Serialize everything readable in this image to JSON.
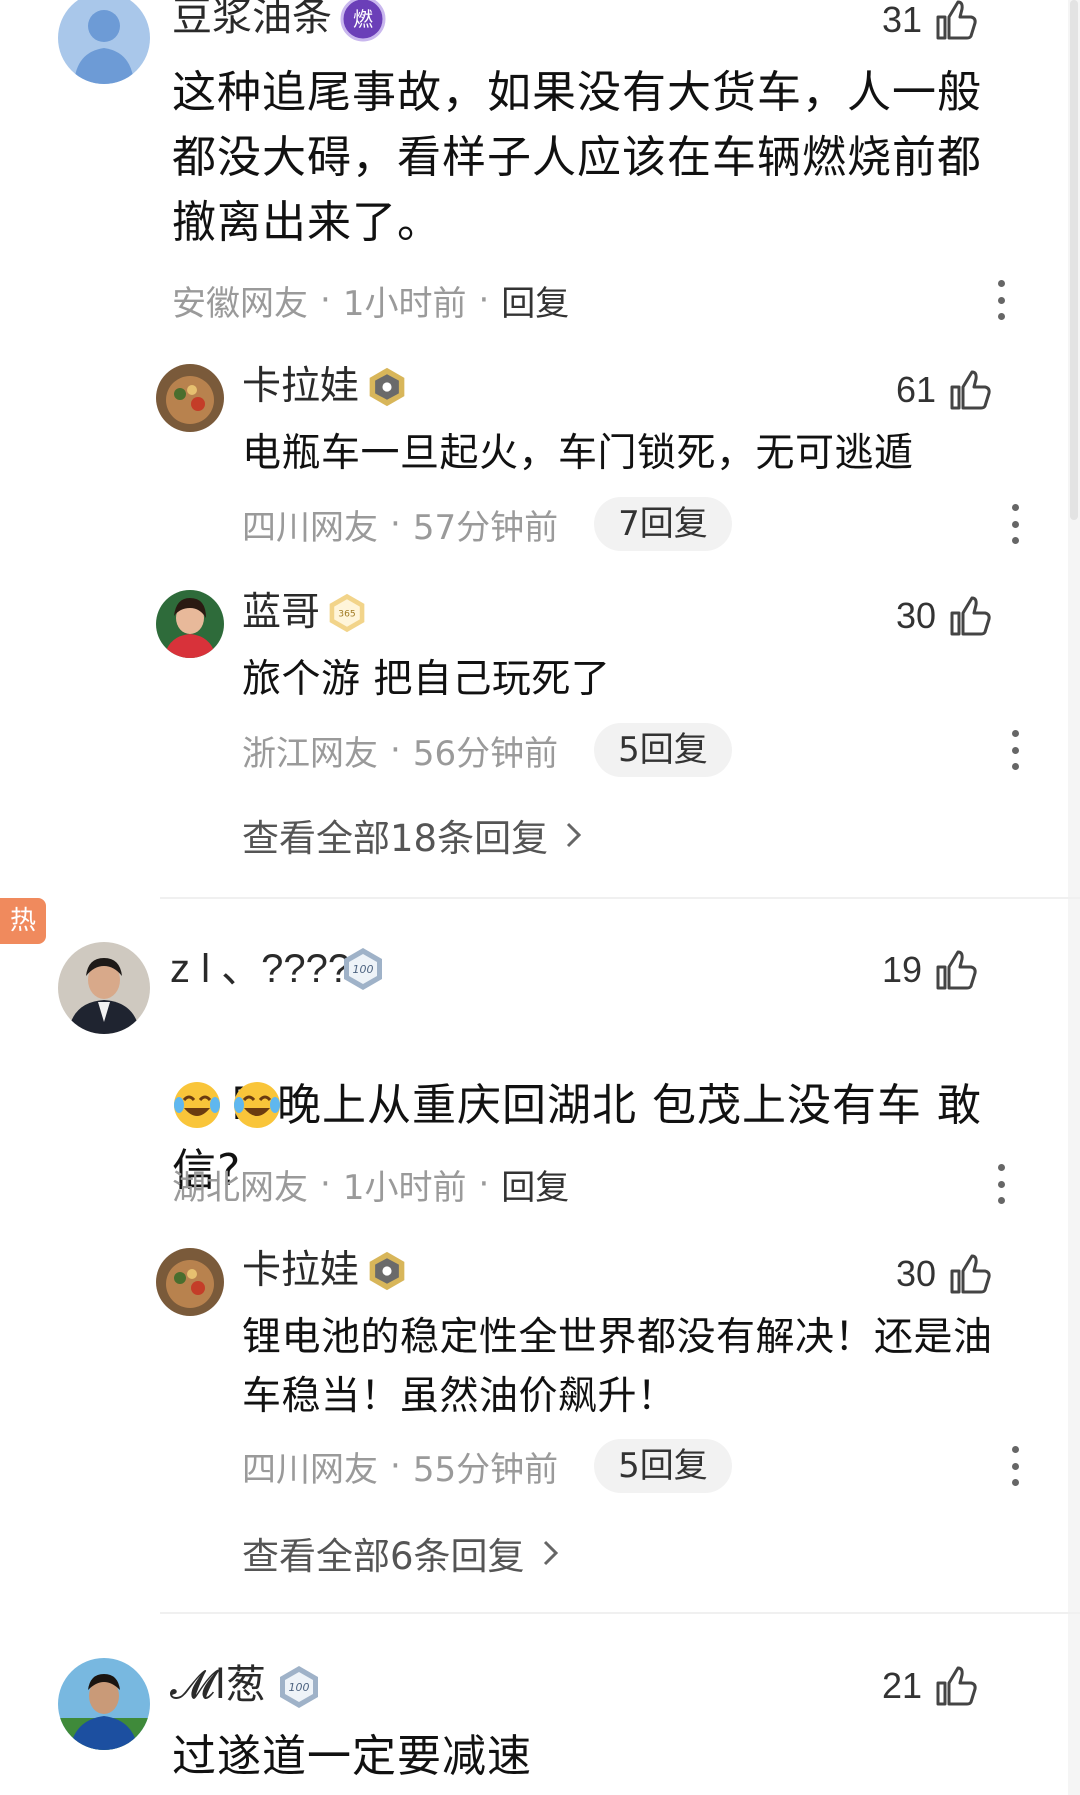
{
  "comments": [
    {
      "username": "豆浆油条",
      "badge_text": "燃",
      "likes": "31",
      "content": "这种追尾事故，如果没有大货车，人一般\n都没大碍，看样子人应该在车辆燃烧前都\n撤离出来了。",
      "location": "安徽网友",
      "time": "1小时前",
      "reply_label": "回复",
      "replies": [
        {
          "username": "卡拉娃",
          "likes": "61",
          "content": "电瓶车一旦起火，车门锁死，无可逃遁",
          "location": "四川网友",
          "time": "57分钟前",
          "reply_count": "7回复"
        },
        {
          "username": "蓝哥",
          "badge_text": "365",
          "likes": "30",
          "content": "旅个游 把自己玩死了",
          "location": "浙江网友",
          "time": "56分钟前",
          "reply_count": "5回复"
        }
      ],
      "view_all": "查看全部18条回复"
    },
    {
      "username": "z l 、????",
      "badge_text": "100",
      "likes": "19",
      "content": "昨晚上从重庆回湖北 包茂上没有车 敢信?",
      "location": "湖北网友",
      "time": "1小时前",
      "reply_label": "回复",
      "replies": [
        {
          "username": "卡拉娃",
          "likes": "30",
          "content": "锂电池的稳定性全世界都没有解决！还是油\n车稳当！虽然油价飙升！",
          "location": "四川网友",
          "time": "55分钟前",
          "reply_count": "5回复"
        }
      ],
      "view_all": "查看全部6条回复"
    },
    {
      "username": "𝓜l葱",
      "badge_text": "100",
      "likes": "21",
      "content": "过遂道一定要减速"
    }
  ],
  "hot_tag": "热",
  "separator": "·",
  "icons": {
    "like": "thumbs-up-icon",
    "more": "more-vertical-icon",
    "emoji": "laughing-tears-emoji"
  }
}
